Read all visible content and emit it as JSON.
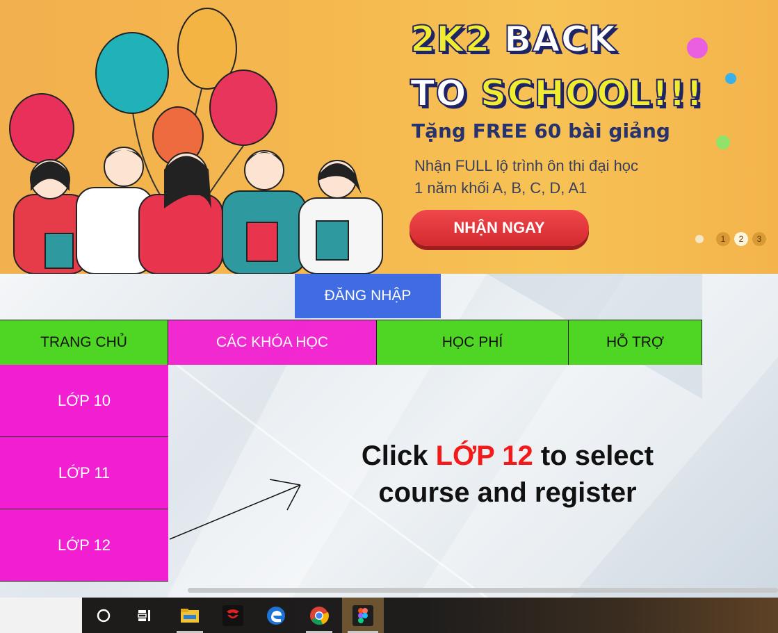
{
  "banner": {
    "headline_line1_part1": "2K2",
    "headline_line1_part2": "BACK",
    "headline_line2_part1": "TO",
    "headline_line2_part2": "SCHOOL!!!",
    "promo": "Tặng FREE 60 bài giảng",
    "sub_line1": "Nhận FULL lộ trình ôn thi đại học",
    "sub_line2": "1 năm khối A, B, C, D, A1",
    "cta_label": "NHẬN NGAY",
    "slides": [
      "1",
      "2",
      "3"
    ],
    "active_slide": "2"
  },
  "login": {
    "label": "ĐĂNG NHẬP"
  },
  "nav": {
    "items": [
      {
        "label": "TRANG CHỦ"
      },
      {
        "label": "CÁC KHÓA HỌC"
      },
      {
        "label": "HỌC PHÍ"
      },
      {
        "label": "HỖ TRỢ"
      }
    ]
  },
  "sidebar": {
    "items": [
      {
        "label": "LỚP 10"
      },
      {
        "label": "LỚP 11"
      },
      {
        "label": "LỚP 12"
      }
    ]
  },
  "hint": {
    "part1": "Click ",
    "highlight": "LỚP 12",
    "part2": " to select",
    "line2": "course and register"
  },
  "taskbar": {
    "icons": [
      "cortana-circle-icon",
      "task-view-icon",
      "file-explorer-icon",
      "garena-icon",
      "edge-icon",
      "chrome-icon",
      "figma-icon"
    ]
  },
  "colors": {
    "nav_green": "#4fd624",
    "nav_pink": "#f218ce",
    "login_blue": "#3f6ce2",
    "hint_red": "#f41a1a"
  }
}
